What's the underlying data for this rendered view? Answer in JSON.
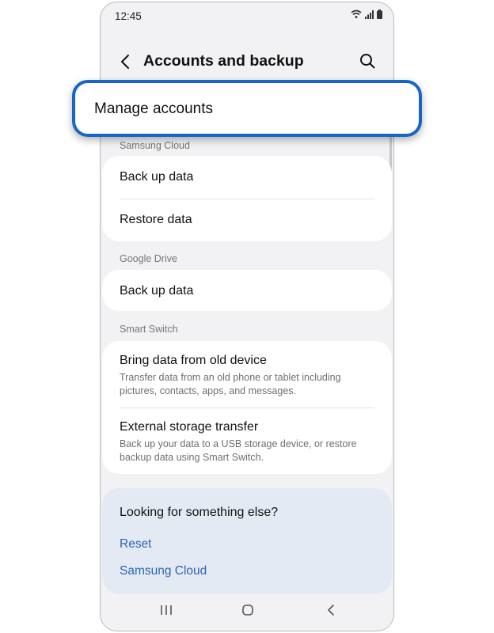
{
  "status_bar": {
    "time": "12:45"
  },
  "app_bar": {
    "title": "Accounts and backup"
  },
  "highlighted_item": {
    "label": "Manage accounts"
  },
  "samsung_cloud": {
    "label": "Samsung Cloud",
    "items": [
      {
        "title": "Back up data"
      },
      {
        "title": "Restore data"
      }
    ]
  },
  "google_drive": {
    "label": "Google Drive",
    "items": [
      {
        "title": "Back up data"
      }
    ]
  },
  "smart_switch": {
    "label": "Smart Switch",
    "items": [
      {
        "title": "Bring data from old device",
        "subtitle_lines": [
          "Transfer data from an old phone or tablet including",
          "pictures, contacts, apps, and messages."
        ]
      },
      {
        "title": "External storage transfer",
        "subtitle_lines": [
          "Back up your data to a USB storage device, or restore",
          "backup data using Smart Switch."
        ]
      }
    ]
  },
  "help": {
    "title": "Looking for something else?",
    "links": [
      "Reset",
      "Samsung Cloud"
    ]
  },
  "colors": {
    "accent": "#1766c7",
    "link": "#2b65b4",
    "help_background": "#e4eaf4"
  }
}
